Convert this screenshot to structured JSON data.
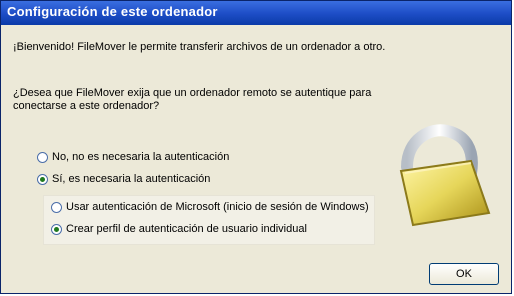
{
  "window": {
    "title": "Configuración de este ordenador"
  },
  "intro_text": "¡Bienvenido! FileMover le permite transferir archivos de un ordenador a otro.",
  "question_text": "¿Desea que FileMover exija que un ordenador remoto se autentique para conectarse a este ordenador?",
  "options": {
    "no_auth": {
      "label": "No, no es necesaria la autenticación",
      "selected": false
    },
    "yes_auth": {
      "label": "Sí, es necesaria la autenticación",
      "selected": true
    },
    "windows_auth": {
      "label": "Usar autenticación de Microsoft (inicio de sesión de Windows)",
      "selected": false
    },
    "custom_profile": {
      "label": "Crear perfil de autenticación de usuario individual",
      "selected": true
    }
  },
  "buttons": {
    "ok": "OK"
  },
  "icons": {
    "lock": "padlock-icon"
  },
  "colors": {
    "titlebar": "#1f4fc8",
    "lock_gold": "#e6d65a"
  }
}
